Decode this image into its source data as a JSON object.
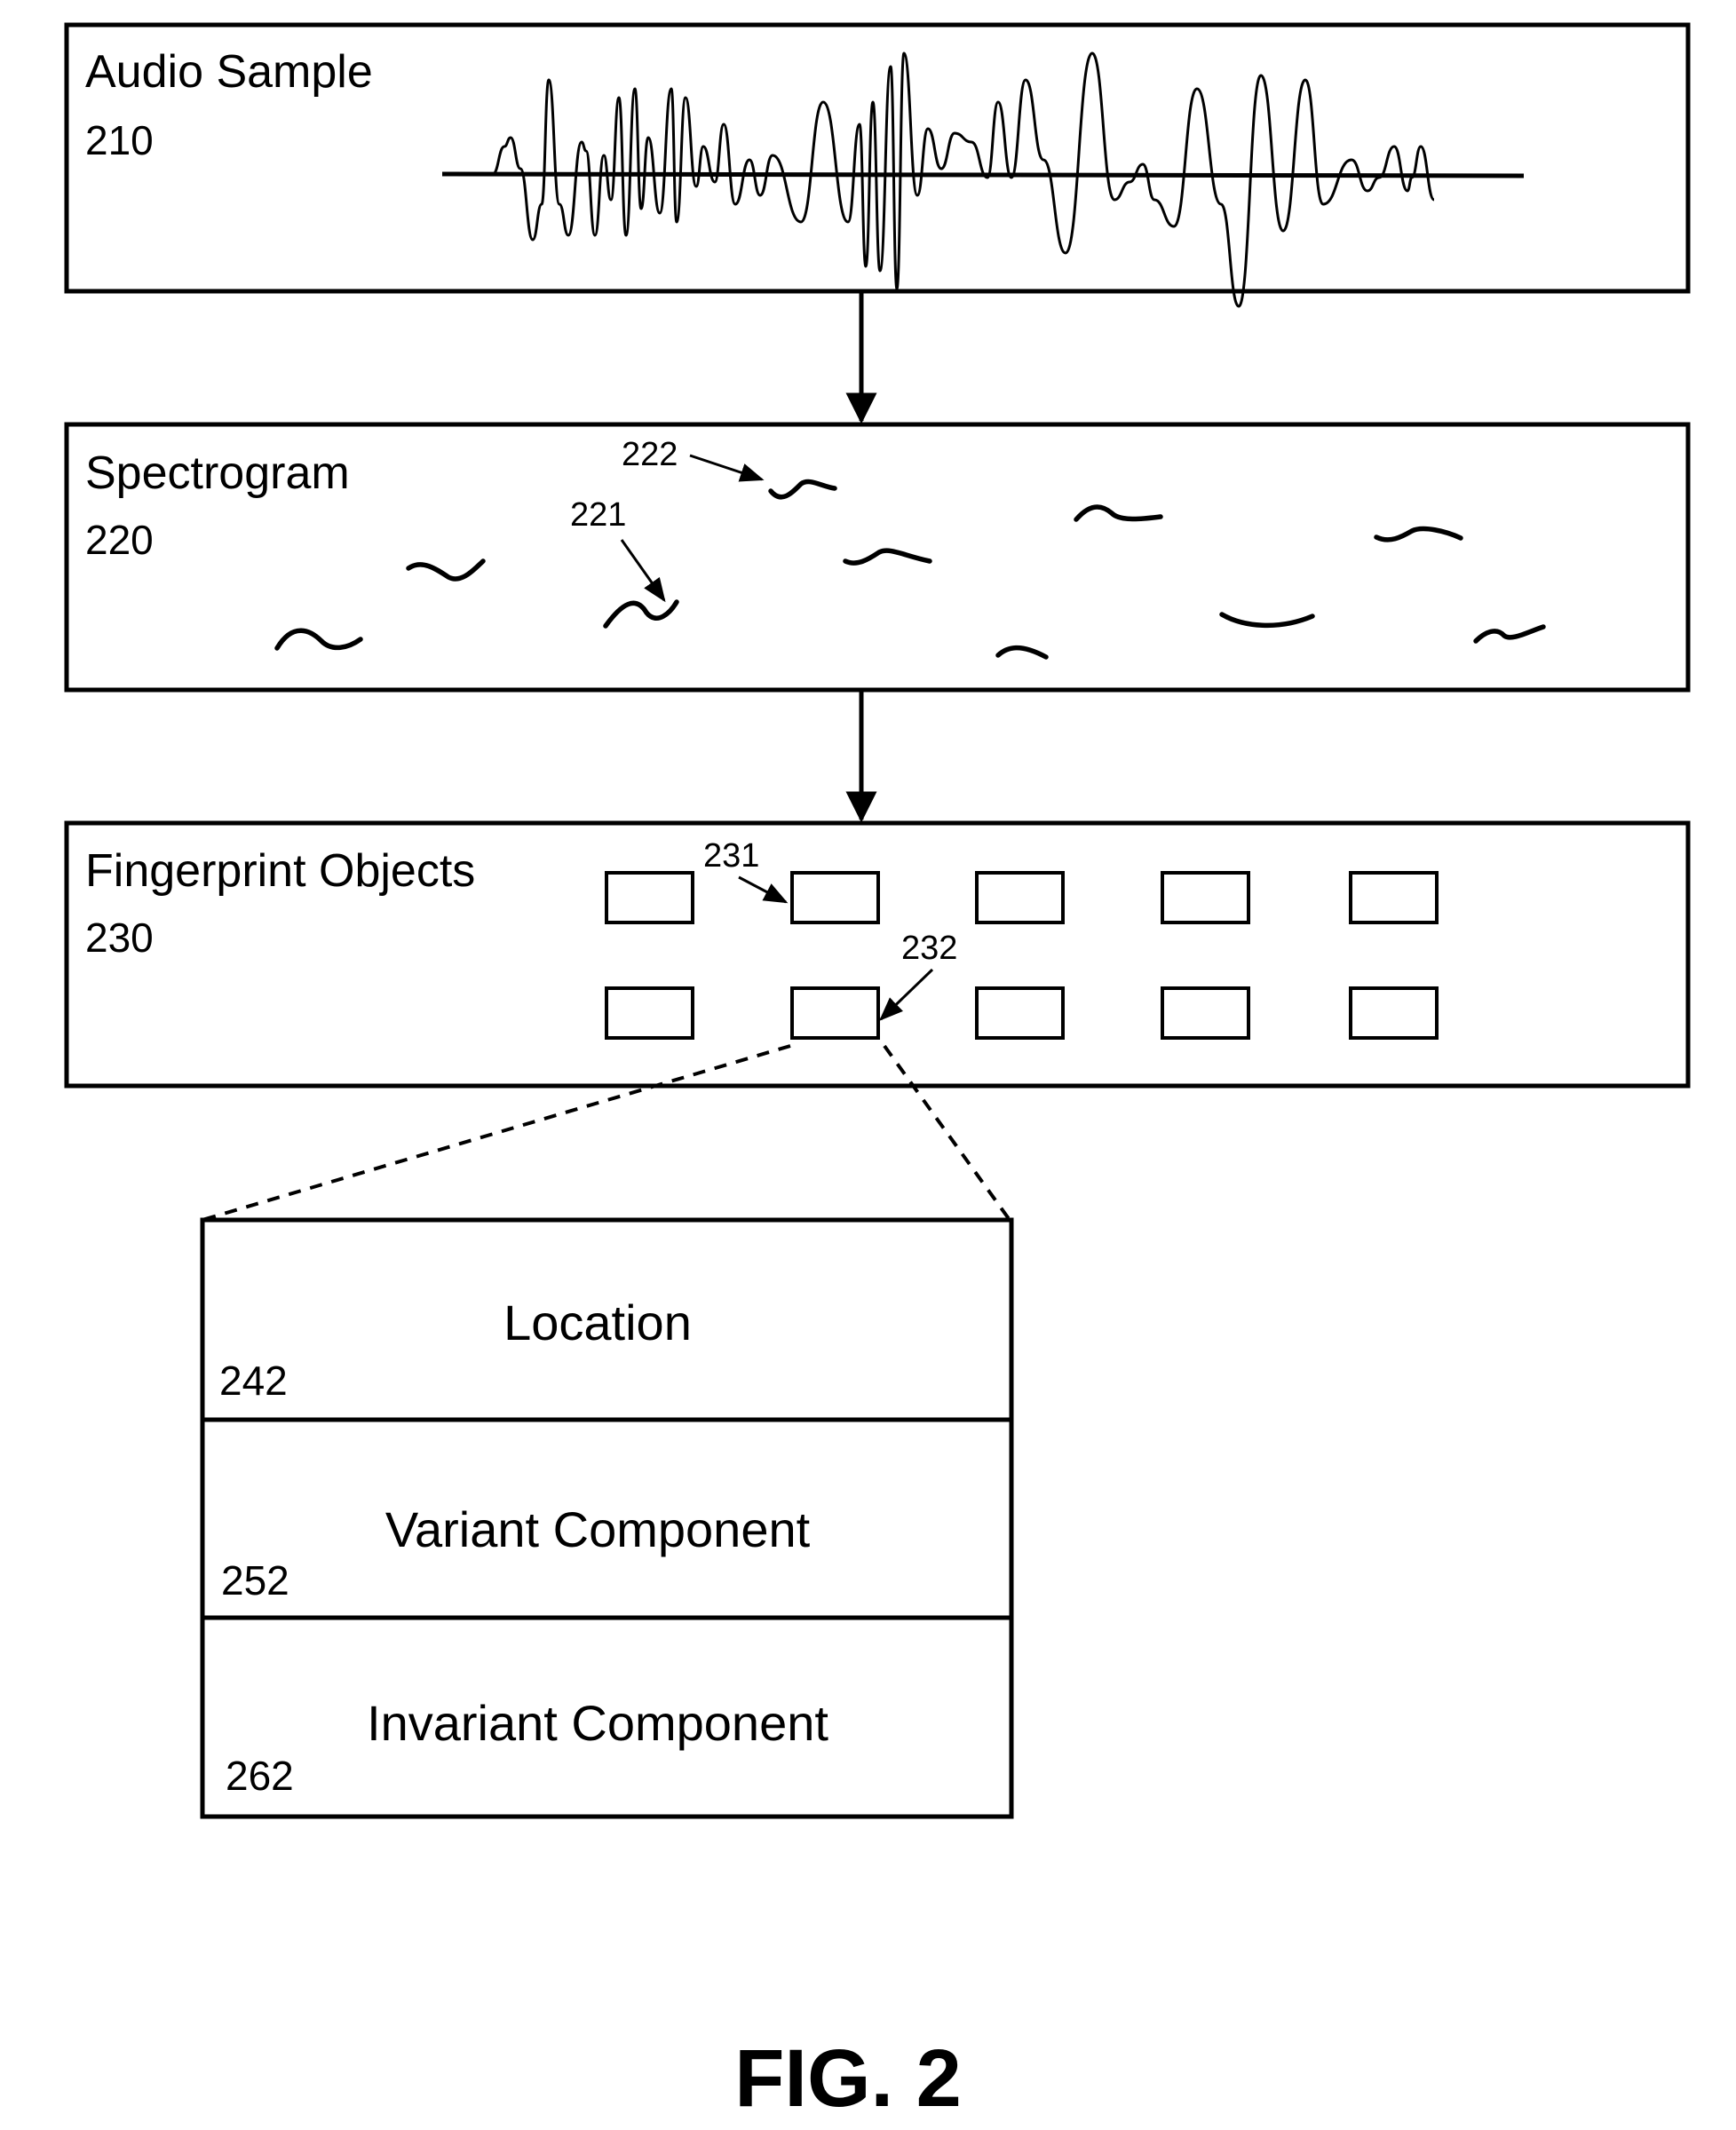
{
  "figure": {
    "caption": "FIG. 2",
    "stages": [
      {
        "title": "Audio Sample",
        "ref": "210"
      },
      {
        "title": "Spectrogram",
        "ref": "220",
        "callouts": [
          "222",
          "221"
        ]
      },
      {
        "title": "Fingerprint Objects",
        "ref": "230",
        "callouts": [
          "231",
          "232"
        ]
      }
    ],
    "fingerprint_object": {
      "fields": [
        {
          "label": "Location",
          "ref": "242"
        },
        {
          "label": "Variant Component",
          "ref": "252"
        },
        {
          "label": "Invariant Component",
          "ref": "262"
        }
      ]
    }
  }
}
